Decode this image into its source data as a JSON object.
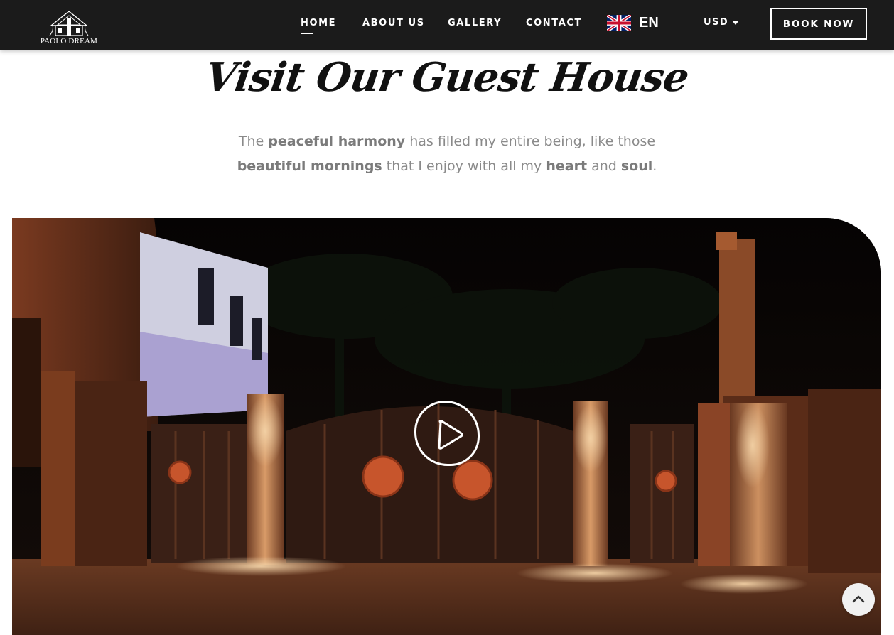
{
  "header": {
    "logo_text": "PAOLO DREAM",
    "nav": [
      {
        "label": "HOME",
        "active": true
      },
      {
        "label": "ABOUT US",
        "active": false
      },
      {
        "label": "GALLERY",
        "active": false
      },
      {
        "label": "CONTACT",
        "active": false
      }
    ],
    "language": {
      "code": "EN",
      "flag_icon": "uk-flag-icon"
    },
    "currency": {
      "label": "USD",
      "icon": "caret-down-icon"
    },
    "book_label": "BOOK NOW"
  },
  "section": {
    "title": "Visit Our Guest House",
    "intro": {
      "t1": "The ",
      "b1": "peaceful harmony",
      "t2": " has filled my entire being, like those ",
      "b2": "beautiful mornings",
      "t3": " that I enjoy with all my ",
      "b3": "heart",
      "t4": " and ",
      "b4": "soul",
      "t5": "."
    }
  },
  "video": {
    "play_icon": "play-icon"
  },
  "back_to_top": {
    "icon": "chevron-up-icon"
  },
  "colors": {
    "header_bg": "#1b1b1b",
    "text_muted": "#8a8a8a",
    "title": "#111111"
  }
}
